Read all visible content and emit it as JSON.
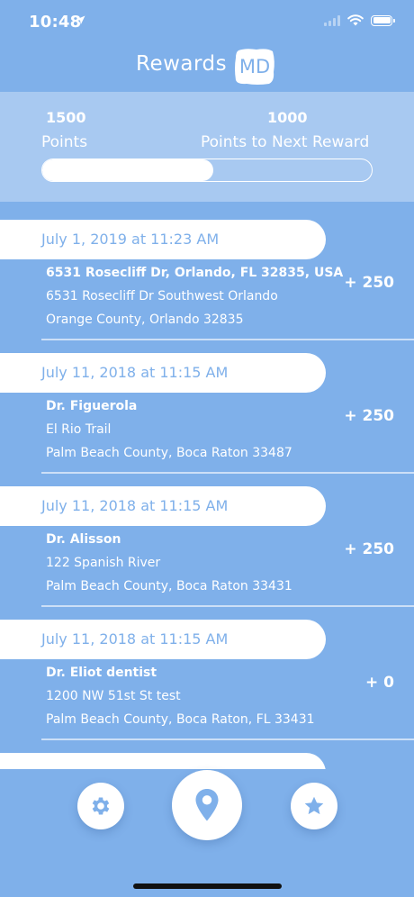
{
  "status_bar": {
    "time": "10:48"
  },
  "header": {
    "title": "Rewards",
    "logo_text": "MD"
  },
  "points": {
    "current_value": "1500",
    "current_label": "Points",
    "next_value": "1000",
    "next_label": "Points to Next Reward",
    "progress_fraction": 0.52
  },
  "entries": [
    {
      "date": "July 1, 2019 at 11:23 AM",
      "name": "6531 Rosecliff Dr, Orlando, FL 32835, USA",
      "line1": "6531 Rosecliff Dr Southwest Orlando",
      "line2": "Orange County, Orlando 32835",
      "points": "+ 250"
    },
    {
      "date": "July 11, 2018 at 11:15 AM",
      "name": "Dr. Figuerola",
      "line1": "El Rio Trail",
      "line2": "Palm Beach County, Boca Raton 33487",
      "points": "+ 250"
    },
    {
      "date": "July 11, 2018 at 11:15 AM",
      "name": "Dr. Alisson",
      "line1": "122 Spanish River",
      "line2": "Palm Beach County, Boca Raton 33431",
      "points": "+ 250"
    },
    {
      "date": "July 11, 2018 at 11:15 AM",
      "name": "Dr. Eliot dentist",
      "line1": "1200 NW 51st St test",
      "line2": "Palm Beach County, Boca Raton, FL 33431",
      "points": "+ 0"
    }
  ],
  "nav": {
    "settings_icon": "gear-icon",
    "checkin_icon": "map-pin-icon",
    "favorites_icon": "star-icon"
  },
  "colors": {
    "background": "#7fb0ea",
    "panel": "#a8c9f1",
    "accent": "#7fb0ea"
  }
}
